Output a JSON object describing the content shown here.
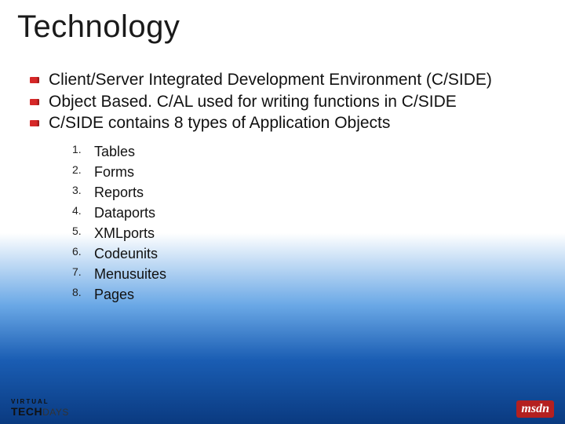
{
  "title": "Technology",
  "bullets": [
    "Client/Server Integrated Development Environment (C/SIDE)",
    "Object Based. C/AL used for writing functions in C/SIDE",
    "C/SIDE contains 8 types of Application Objects"
  ],
  "objects": [
    "Tables",
    "Forms",
    "Reports",
    "Dataports",
    "XMLports",
    "Codeunits",
    "Menusuites",
    "Pages"
  ],
  "footer": {
    "left_line1": "VIRTUAL",
    "left_line2_tech": "TECH",
    "left_line2_days": "DAYS",
    "right_badge": "msdn",
    "right_sub": ""
  }
}
